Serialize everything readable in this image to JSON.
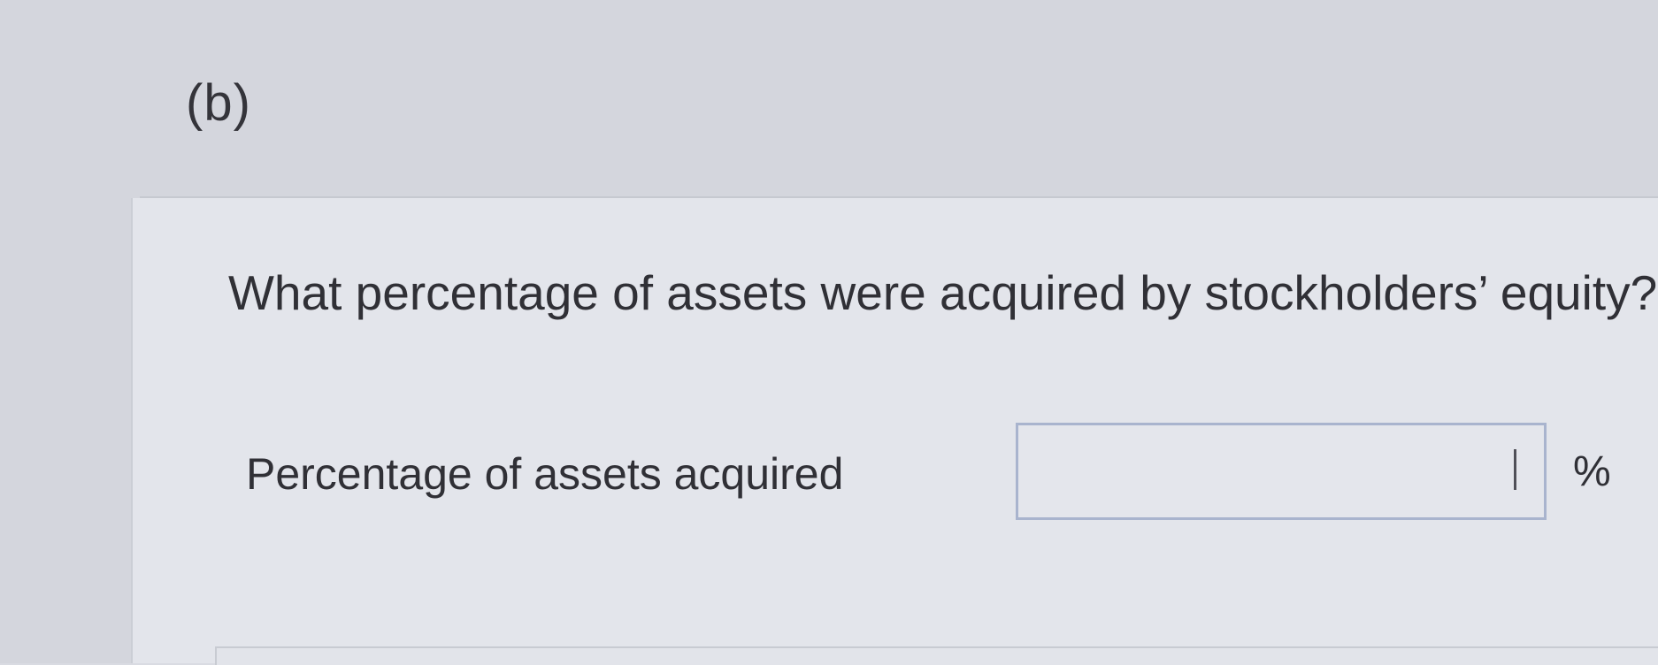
{
  "part": {
    "label": "(b)"
  },
  "question": {
    "text": "What percentage of assets were acquired by stockholders’ equity?"
  },
  "answer": {
    "label": "Percentage of assets acquired",
    "value": "",
    "placeholder": "",
    "unit": "%"
  },
  "colors": {
    "background": "#d9dbe2",
    "panel": "#e3e5eb",
    "text": "#303036",
    "input_border": "#a9b4ce"
  }
}
